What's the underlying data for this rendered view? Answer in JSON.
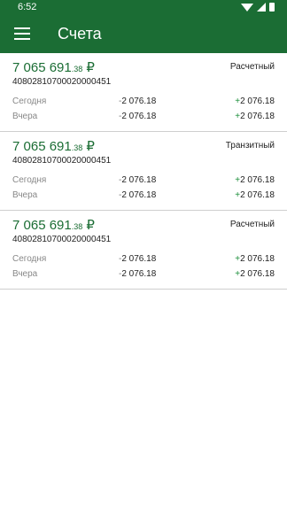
{
  "status": {
    "time": "6:52"
  },
  "appbar": {
    "title": "Счета"
  },
  "accounts": [
    {
      "amount_main": "7 065 691",
      "amount_cents": ".38",
      "currency": "₽",
      "type": "Расчетный",
      "number": "40802810700020000451",
      "today": {
        "label": "Сегодня",
        "neg_sign": "-",
        "neg_value": "2 076.18",
        "pos_sign": "+",
        "pos_value": "2 076.18"
      },
      "yesterday": {
        "label": "Вчера",
        "neg_sign": "-",
        "neg_value": "2 076.18",
        "pos_sign": "+",
        "pos_value": "2 076.18"
      }
    },
    {
      "amount_main": "7 065 691",
      "amount_cents": ".38",
      "currency": "₽",
      "type": "Транзитный",
      "number": "40802810700020000451",
      "today": {
        "label": "Сегодня",
        "neg_sign": "-",
        "neg_value": "2 076.18",
        "pos_sign": "+",
        "pos_value": "2 076.18"
      },
      "yesterday": {
        "label": "Вчера",
        "neg_sign": "-",
        "neg_value": "2 076.18",
        "pos_sign": "+",
        "pos_value": "2 076.18"
      }
    },
    {
      "amount_main": "7 065 691",
      "amount_cents": ".38",
      "currency": "₽",
      "type": "Расчетный",
      "number": "40802810700020000451",
      "today": {
        "label": "Сегодня",
        "neg_sign": "-",
        "neg_value": "2 076.18",
        "pos_sign": "+",
        "pos_value": "2 076.18"
      },
      "yesterday": {
        "label": "Вчера",
        "neg_sign": "-",
        "neg_value": "2 076.18",
        "pos_sign": "+",
        "pos_value": "2 076.18"
      }
    }
  ]
}
